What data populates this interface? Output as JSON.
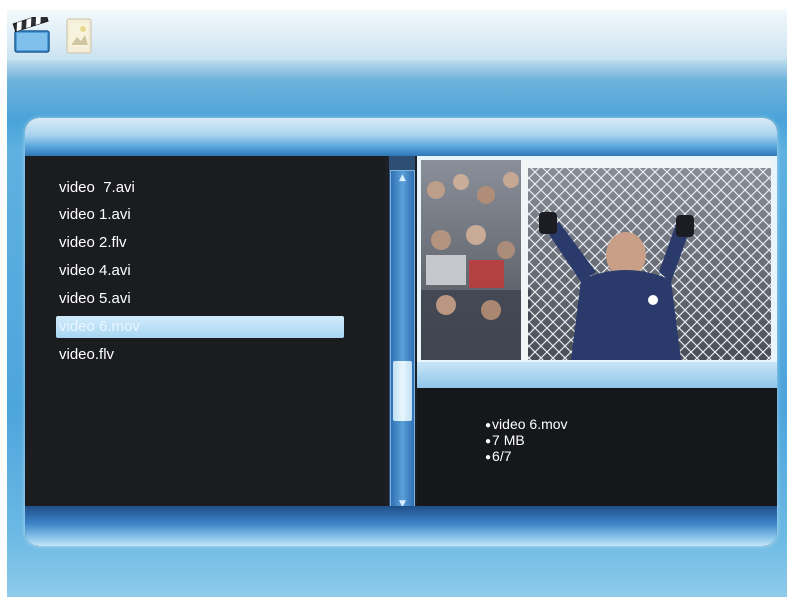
{
  "top_bar": {
    "tabs": [
      {
        "icon": "clapperboard-icon"
      },
      {
        "icon": "photo-icon"
      }
    ]
  },
  "file_list": {
    "items": [
      {
        "label": "video  7.avi"
      },
      {
        "label": "video 1.avi"
      },
      {
        "label": "video 2.flv"
      },
      {
        "label": "video 4.avi"
      },
      {
        "label": "video 5.avi"
      },
      {
        "label": "video 6.mov"
      },
      {
        "label": "video.flv"
      }
    ],
    "selected_index": 5
  },
  "info": {
    "filename": "video 6.mov",
    "size": "7 MB",
    "position": "6/7"
  },
  "colors": {
    "accent_blue": "#4aa3d9",
    "panel_dark": "#1a1c1f",
    "selection": "#a7d5f3"
  }
}
